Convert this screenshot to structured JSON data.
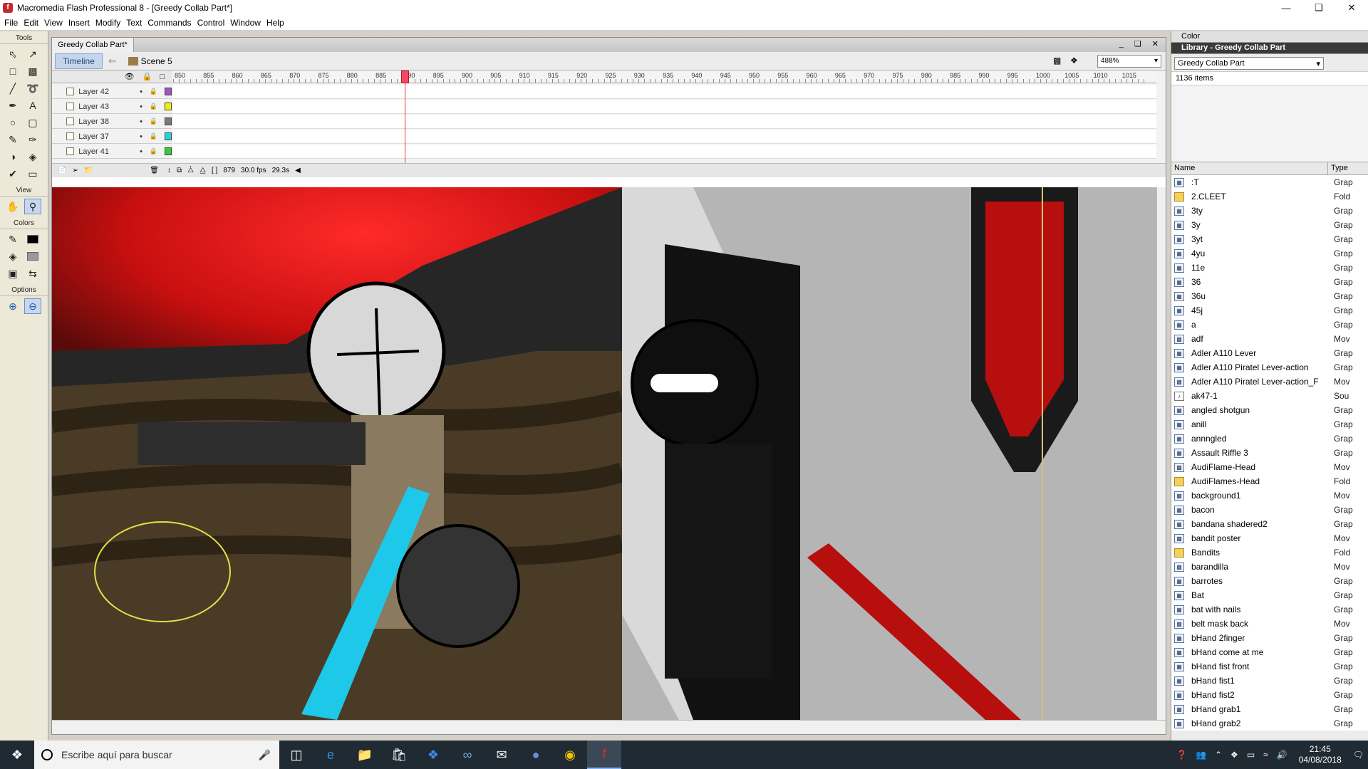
{
  "window": {
    "title": "Macromedia Flash Professional 8 - [Greedy Collab Part*]"
  },
  "menu": [
    "File",
    "Edit",
    "View",
    "Insert",
    "Modify",
    "Text",
    "Commands",
    "Control",
    "Window",
    "Help"
  ],
  "tools": {
    "title": "Tools",
    "view_label": "View",
    "colors_label": "Colors",
    "options_label": "Options"
  },
  "document": {
    "tab": "Greedy Collab Part*",
    "timeline_button": "Timeline",
    "scene": "Scene 5",
    "zoom": "488%"
  },
  "timeline": {
    "ruler": [
      "850",
      "855",
      "860",
      "865",
      "870",
      "875",
      "880",
      "885",
      "890",
      "895",
      "900",
      "905",
      "910",
      "915",
      "920",
      "925",
      "930",
      "935",
      "940",
      "945",
      "950",
      "955",
      "960",
      "965",
      "970",
      "975",
      "980",
      "985",
      "990",
      "995",
      "1000",
      "1005",
      "1010",
      "1015"
    ],
    "current_frame": 879,
    "layers": [
      {
        "name": "Layer 42",
        "color": "#a64dcc"
      },
      {
        "name": "Layer 43",
        "color": "#f0f000"
      },
      {
        "name": "Layer 38",
        "color": "#7a7a7a"
      },
      {
        "name": "Layer 37",
        "color": "#22d6d6"
      },
      {
        "name": "Layer 41",
        "color": "#33cc33"
      }
    ],
    "footer": {
      "frame": "879",
      "fps": "30.0 fps",
      "time": "29.3s"
    }
  },
  "panels": {
    "color": "Color",
    "library_title": "Library - Greedy Collab Part",
    "library_select": "Greedy Collab Part",
    "item_count": "1136 items",
    "col_name": "Name",
    "col_type": "Type"
  },
  "library": [
    {
      "name": ":T",
      "type": "Grap",
      "icon": "graphic"
    },
    {
      "name": "2.CLEET",
      "type": "Fold",
      "icon": "folder"
    },
    {
      "name": "3ty",
      "type": "Grap",
      "icon": "graphic"
    },
    {
      "name": "3y",
      "type": "Grap",
      "icon": "graphic"
    },
    {
      "name": "3yt",
      "type": "Grap",
      "icon": "graphic"
    },
    {
      "name": "4yu",
      "type": "Grap",
      "icon": "graphic"
    },
    {
      "name": "11e",
      "type": "Grap",
      "icon": "graphic"
    },
    {
      "name": "36",
      "type": "Grap",
      "icon": "graphic"
    },
    {
      "name": "36u",
      "type": "Grap",
      "icon": "graphic"
    },
    {
      "name": "45j",
      "type": "Grap",
      "icon": "graphic"
    },
    {
      "name": "a",
      "type": "Grap",
      "icon": "graphic"
    },
    {
      "name": "adf",
      "type": "Mov",
      "icon": "movie"
    },
    {
      "name": "Adler A110 Lever",
      "type": "Grap",
      "icon": "graphic"
    },
    {
      "name": "Adler A110 Piratel Lever-action",
      "type": "Grap",
      "icon": "graphic"
    },
    {
      "name": "Adler A110 Piratel Lever-action_F",
      "type": "Mov",
      "icon": "movie"
    },
    {
      "name": "ak47-1",
      "type": "Sou",
      "icon": "sound"
    },
    {
      "name": "angled shotgun",
      "type": "Grap",
      "icon": "graphic"
    },
    {
      "name": "anill",
      "type": "Grap",
      "icon": "graphic"
    },
    {
      "name": "annngled",
      "type": "Grap",
      "icon": "graphic"
    },
    {
      "name": "Assault Riffle 3",
      "type": "Grap",
      "icon": "graphic"
    },
    {
      "name": "AudiFlame-Head",
      "type": "Mov",
      "icon": "movie"
    },
    {
      "name": "AudiFlames-Head",
      "type": "Fold",
      "icon": "folder"
    },
    {
      "name": "background1",
      "type": "Mov",
      "icon": "movie"
    },
    {
      "name": "bacon",
      "type": "Grap",
      "icon": "graphic"
    },
    {
      "name": "bandana shadered2",
      "type": "Grap",
      "icon": "graphic"
    },
    {
      "name": "bandit poster",
      "type": "Mov",
      "icon": "movie"
    },
    {
      "name": "Bandits",
      "type": "Fold",
      "icon": "folder"
    },
    {
      "name": "barandilla",
      "type": "Mov",
      "icon": "movie"
    },
    {
      "name": "barrotes",
      "type": "Grap",
      "icon": "graphic"
    },
    {
      "name": "Bat",
      "type": "Grap",
      "icon": "graphic"
    },
    {
      "name": "bat with nails",
      "type": "Grap",
      "icon": "graphic"
    },
    {
      "name": "belt mask back",
      "type": "Mov",
      "icon": "movie"
    },
    {
      "name": "bHand 2finger",
      "type": "Grap",
      "icon": "graphic"
    },
    {
      "name": "bHand come at me",
      "type": "Grap",
      "icon": "graphic"
    },
    {
      "name": "bHand fist front",
      "type": "Grap",
      "icon": "graphic"
    },
    {
      "name": "bHand fist1",
      "type": "Grap",
      "icon": "graphic"
    },
    {
      "name": "bHand fist2",
      "type": "Grap",
      "icon": "graphic"
    },
    {
      "name": "bHand grab1",
      "type": "Grap",
      "icon": "graphic"
    },
    {
      "name": "bHand grab2",
      "type": "Grap",
      "icon": "graphic"
    }
  ],
  "taskbar": {
    "search_placeholder": "Escribe aquí para buscar",
    "time": "21:45",
    "date": "04/08/2018"
  }
}
